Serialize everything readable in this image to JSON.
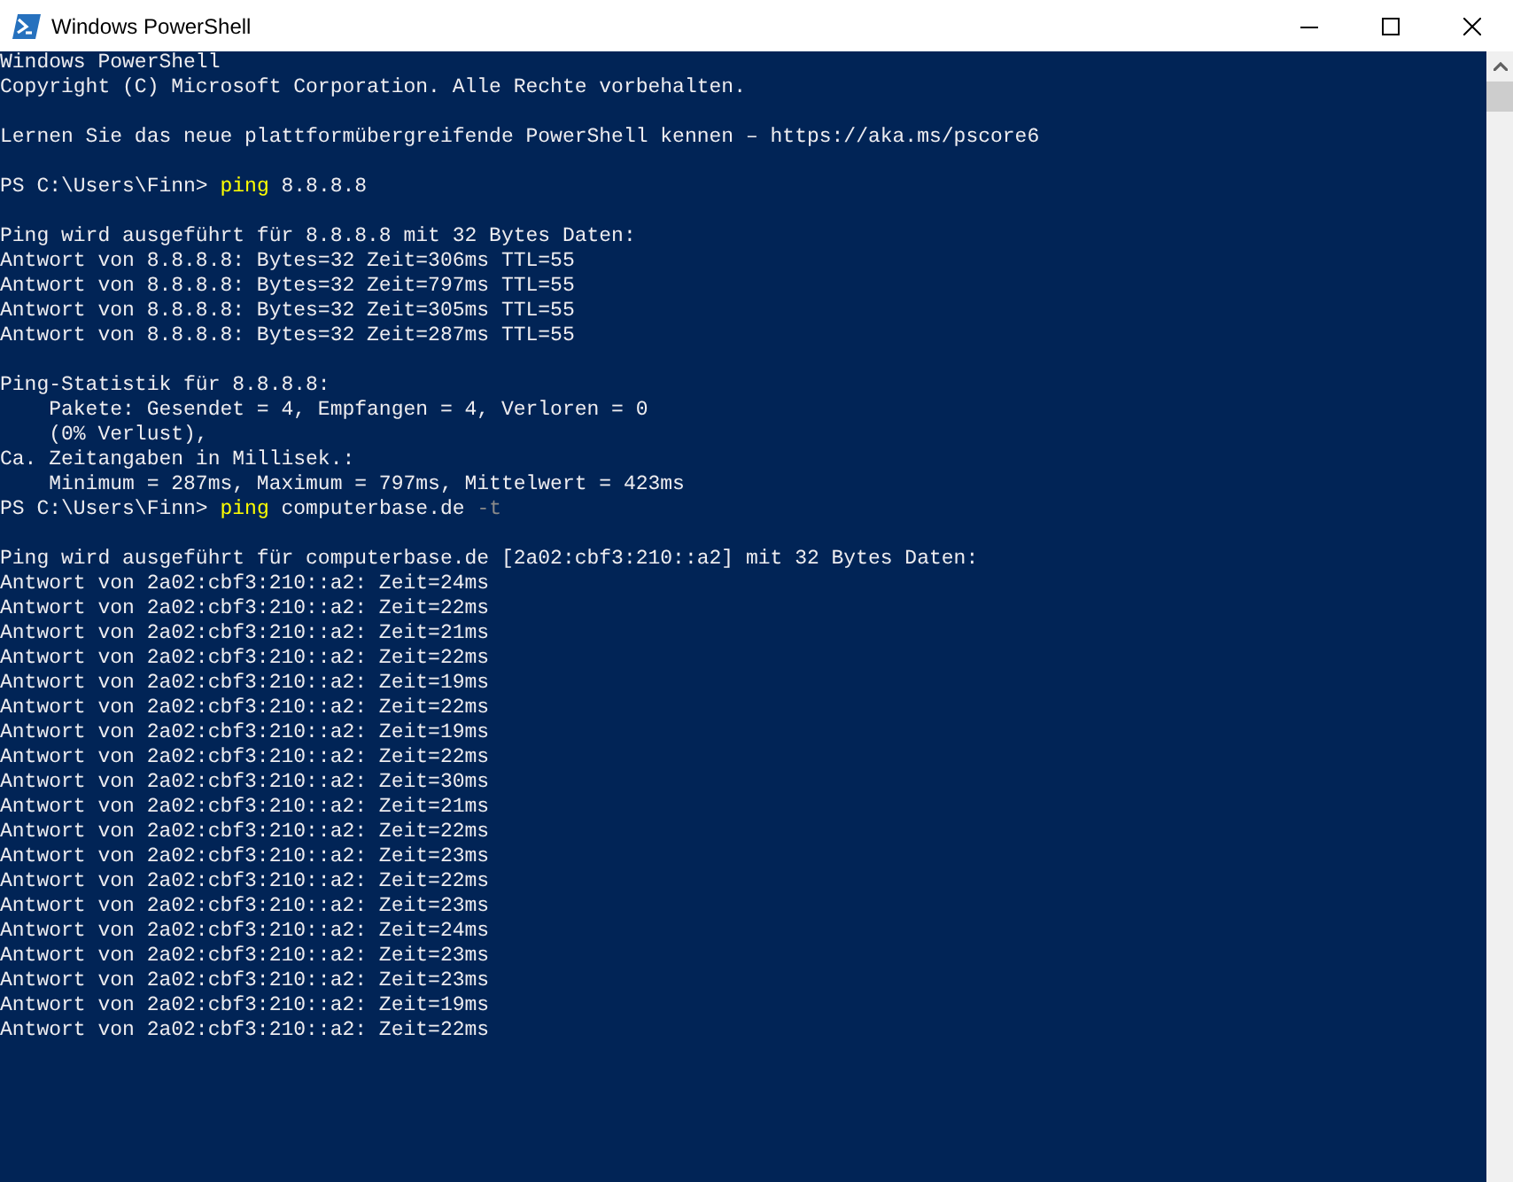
{
  "window": {
    "title": "Windows PowerShell"
  },
  "console": {
    "lines": [
      {
        "kind": "output",
        "text": "Windows PowerShell"
      },
      {
        "kind": "output",
        "text": "Copyright (C) Microsoft Corporation. Alle Rechte vorbehalten."
      },
      {
        "kind": "blank"
      },
      {
        "kind": "output",
        "text": "Lernen Sie das neue plattformübergreifende PowerShell kennen – https://aka.ms/pscore6"
      },
      {
        "kind": "blank"
      },
      {
        "kind": "prompt",
        "prompt": "PS C:\\Users\\Finn>",
        "command": "ping",
        "args": "8.8.8.8"
      },
      {
        "kind": "blank"
      },
      {
        "kind": "output",
        "text": "Ping wird ausgeführt für 8.8.8.8 mit 32 Bytes Daten:"
      },
      {
        "kind": "output",
        "text": "Antwort von 8.8.8.8: Bytes=32 Zeit=306ms TTL=55"
      },
      {
        "kind": "output",
        "text": "Antwort von 8.8.8.8: Bytes=32 Zeit=797ms TTL=55"
      },
      {
        "kind": "output",
        "text": "Antwort von 8.8.8.8: Bytes=32 Zeit=305ms TTL=55"
      },
      {
        "kind": "output",
        "text": "Antwort von 8.8.8.8: Bytes=32 Zeit=287ms TTL=55"
      },
      {
        "kind": "blank"
      },
      {
        "kind": "output",
        "text": "Ping-Statistik für 8.8.8.8:"
      },
      {
        "kind": "output",
        "text": "    Pakete: Gesendet = 4, Empfangen = 4, Verloren = 0"
      },
      {
        "kind": "output",
        "text": "    (0% Verlust),"
      },
      {
        "kind": "output",
        "text": "Ca. Zeitangaben in Millisek.:"
      },
      {
        "kind": "output",
        "text": "    Minimum = 287ms, Maximum = 797ms, Mittelwert = 423ms"
      },
      {
        "kind": "prompt",
        "prompt": "PS C:\\Users\\Finn>",
        "command": "ping",
        "args": "computerbase.de",
        "flag": "-t"
      },
      {
        "kind": "blank"
      },
      {
        "kind": "output",
        "text": "Ping wird ausgeführt für computerbase.de [2a02:cbf3:210::a2] mit 32 Bytes Daten:"
      },
      {
        "kind": "output",
        "text": "Antwort von 2a02:cbf3:210::a2: Zeit=24ms"
      },
      {
        "kind": "output",
        "text": "Antwort von 2a02:cbf3:210::a2: Zeit=22ms"
      },
      {
        "kind": "output",
        "text": "Antwort von 2a02:cbf3:210::a2: Zeit=21ms"
      },
      {
        "kind": "output",
        "text": "Antwort von 2a02:cbf3:210::a2: Zeit=22ms"
      },
      {
        "kind": "output",
        "text": "Antwort von 2a02:cbf3:210::a2: Zeit=19ms"
      },
      {
        "kind": "output",
        "text": "Antwort von 2a02:cbf3:210::a2: Zeit=22ms"
      },
      {
        "kind": "output",
        "text": "Antwort von 2a02:cbf3:210::a2: Zeit=19ms"
      },
      {
        "kind": "output",
        "text": "Antwort von 2a02:cbf3:210::a2: Zeit=22ms"
      },
      {
        "kind": "output",
        "text": "Antwort von 2a02:cbf3:210::a2: Zeit=30ms"
      },
      {
        "kind": "output",
        "text": "Antwort von 2a02:cbf3:210::a2: Zeit=21ms"
      },
      {
        "kind": "output",
        "text": "Antwort von 2a02:cbf3:210::a2: Zeit=22ms"
      },
      {
        "kind": "output",
        "text": "Antwort von 2a02:cbf3:210::a2: Zeit=23ms"
      },
      {
        "kind": "output",
        "text": "Antwort von 2a02:cbf3:210::a2: Zeit=22ms"
      },
      {
        "kind": "output",
        "text": "Antwort von 2a02:cbf3:210::a2: Zeit=23ms"
      },
      {
        "kind": "output",
        "text": "Antwort von 2a02:cbf3:210::a2: Zeit=24ms"
      },
      {
        "kind": "output",
        "text": "Antwort von 2a02:cbf3:210::a2: Zeit=23ms"
      },
      {
        "kind": "output",
        "text": "Antwort von 2a02:cbf3:210::a2: Zeit=23ms"
      },
      {
        "kind": "output",
        "text": "Antwort von 2a02:cbf3:210::a2: Zeit=19ms"
      },
      {
        "kind": "output",
        "text": "Antwort von 2a02:cbf3:210::a2: Zeit=22ms"
      }
    ]
  }
}
